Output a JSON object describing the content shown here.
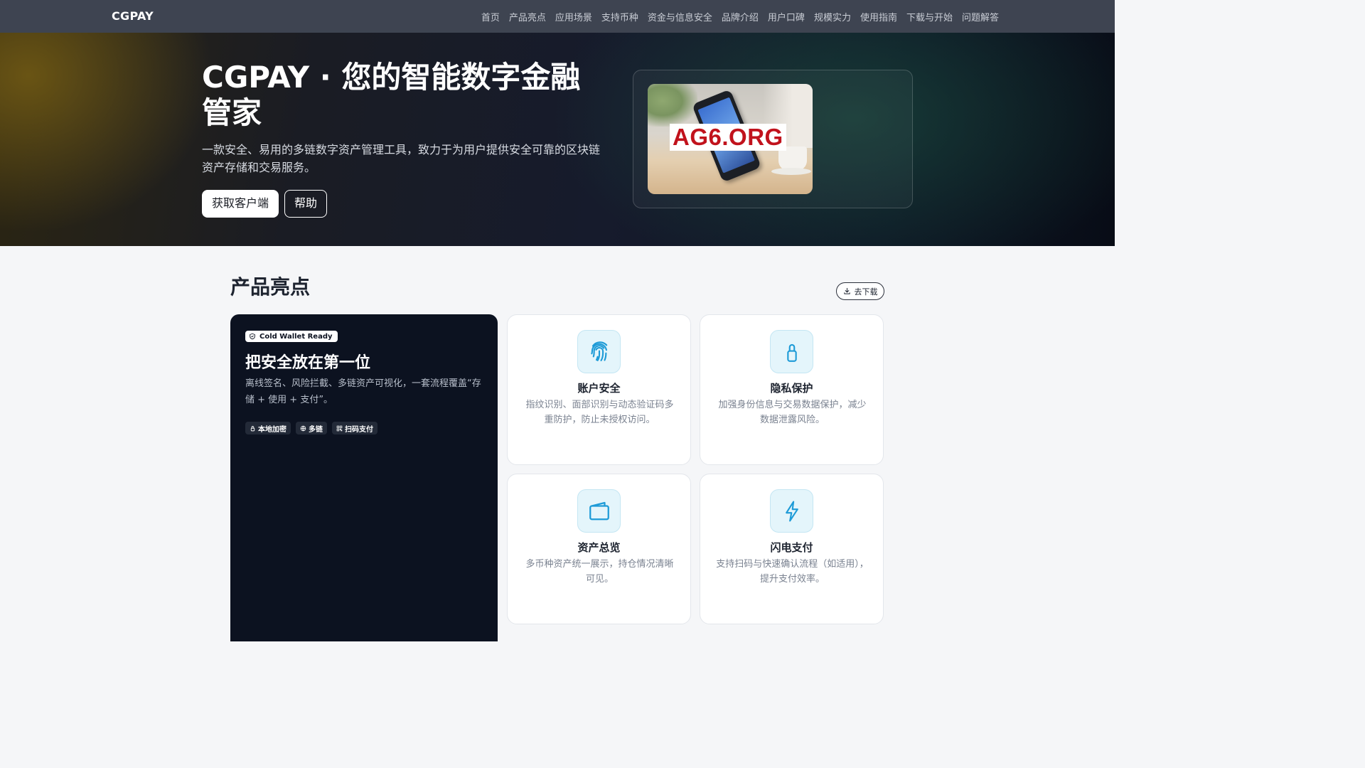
{
  "brand": "CGPAY",
  "nav": [
    "首页",
    "产品亮点",
    "应用场景",
    "支持币种",
    "资金与信息安全",
    "品牌介绍",
    "用户口碑",
    "规模实力",
    "使用指南",
    "下载与开始",
    "问题解答"
  ],
  "hero": {
    "title": "CGPAY · 您的智能数字金融管家",
    "subtitle": "一款安全、易用的多链数字资产管理工具，致力于为用户提供安全可靠的区块链资产存储和交易服务。",
    "primary_button": "获取客户端",
    "secondary_button": "帮助",
    "image_label": "AG6.ORG"
  },
  "highlights": {
    "title": "产品亮点",
    "download_label": "去下载",
    "featured": {
      "badge": "Cold Wallet Ready",
      "title": "把安全放在第一位",
      "desc": "离线签名、风险拦截、多链资产可视化，一套流程覆盖“存储 + 使用 + 支付”。",
      "chips": [
        "本地加密",
        "多链",
        "扫码支付"
      ]
    },
    "features": [
      {
        "icon": "fingerprint-icon",
        "title": "账户安全",
        "desc": "指纹识别、面部识别与动态验证码多重防护，防止未授权访问。"
      },
      {
        "icon": "lock-icon",
        "title": "隐私保护",
        "desc": "加强身份信息与交易数据保护，减少数据泄露风险。"
      },
      {
        "icon": "wallet-icon",
        "title": "资产总览",
        "desc": "多币种资产统一展示，持仓情况清晰可见。"
      },
      {
        "icon": "lightning-icon",
        "title": "闪电支付",
        "desc": "支持扫码与快速确认流程（如适用），提升支付效率。"
      }
    ]
  },
  "colors": {
    "accent": "#1e9bd7",
    "dark_card": "#0c1220",
    "nav_bg": "#3e4451"
  }
}
